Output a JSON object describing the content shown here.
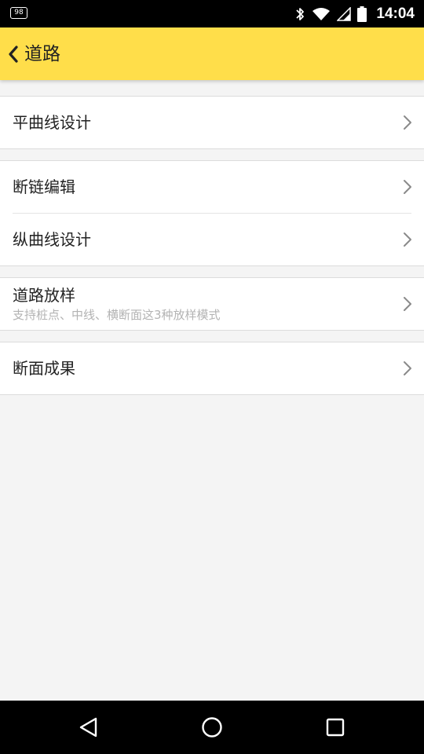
{
  "status_bar": {
    "notification_badge": "98",
    "time": "14:04",
    "icons": [
      "bluetooth-icon",
      "wifi-icon",
      "signal-icon",
      "battery-icon"
    ]
  },
  "app_bar": {
    "title": "道路",
    "back_icon": "chevron-left-icon",
    "background": "#ffde4a"
  },
  "groups": [
    {
      "items": [
        {
          "label": "平曲线设计"
        }
      ]
    },
    {
      "items": [
        {
          "label": "断链编辑"
        },
        {
          "label": "纵曲线设计"
        }
      ]
    },
    {
      "items": [
        {
          "label": "道路放样",
          "sublabel": "支持桩点、中线、横断面这3种放样模式"
        }
      ]
    },
    {
      "items": [
        {
          "label": "断面成果"
        }
      ]
    }
  ],
  "nav_bar": {
    "buttons": [
      "back-triangle-icon",
      "home-circle-icon",
      "recents-square-icon"
    ]
  }
}
